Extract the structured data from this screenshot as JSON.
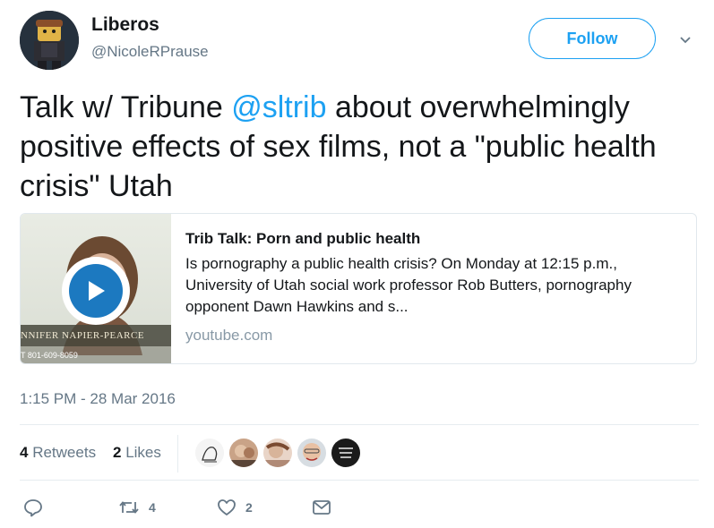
{
  "user": {
    "name": "Liberos",
    "handle": "@NicoleRPrause",
    "follow_label": "Follow"
  },
  "tweet": {
    "text_before": "Talk w/ Tribune ",
    "mention": "@sltrib",
    "text_after": " about overwhelmingly positive effects of sex films, not a \"public health crisis\" Utah"
  },
  "card": {
    "title": "Trib Talk: Porn and public health",
    "description": "Is pornography a public health crisis? On Monday at 12:15 p.m., University of Utah social work professor Rob Butters, pornography opponent Dawn Hawkins and s...",
    "domain": "youtube.com",
    "thumb_caption": "NNIFER NAPIER-PEARCE",
    "thumb_phone": "T 801-609-8059"
  },
  "timestamp": "1:15 PM - 28 Mar 2016",
  "stats": {
    "retweets_count": "4",
    "retweets_label": "Retweets",
    "likes_count": "2",
    "likes_label": "Likes"
  },
  "actions": {
    "retweet_count": "4",
    "like_count": "2"
  },
  "colors": {
    "accent": "#1da1f2",
    "text": "#14171a",
    "muted": "#657786"
  },
  "icons": [
    "reply-icon",
    "retweet-icon",
    "heart-icon",
    "message-icon",
    "play-icon",
    "chevron-down-icon"
  ]
}
